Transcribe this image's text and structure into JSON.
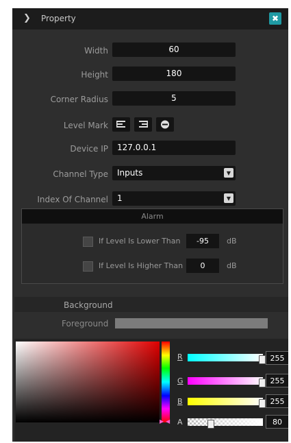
{
  "header": {
    "title": "Property",
    "expand_icon": "chevron-right-icon",
    "pin_icon": "pin-icon"
  },
  "props": {
    "width_label": "Width",
    "width_value": "60",
    "height_label": "Height",
    "height_value": "180",
    "corner_label": "Corner Radius",
    "corner_value": "5",
    "level_mark_label": "Level Mark",
    "level_mark_icons": [
      "align-left-icon",
      "align-right-icon",
      "minus-circle-icon"
    ],
    "device_ip_label": "Device IP",
    "device_ip_value": "127.0.0.1",
    "channel_type_label": "Channel Type",
    "channel_type_value": "Inputs",
    "index_label": "Index Of Channel",
    "index_value": "1"
  },
  "alarm": {
    "title": "Alarm",
    "lower_label": "If Level Is Lower Than",
    "lower_value": "-95",
    "lower_unit": "dB",
    "higher_label": "If Level Is Higher Than",
    "higher_value": "0",
    "higher_unit": "dB"
  },
  "background": {
    "title": "Background",
    "foreground_label": "Foreground",
    "foreground_color": "#7c7c7c"
  },
  "picker": {
    "channels": [
      {
        "label": "R",
        "value": "255"
      },
      {
        "label": "G",
        "value": "255"
      },
      {
        "label": "B",
        "value": "255"
      },
      {
        "label": "A",
        "value": "80"
      }
    ]
  },
  "colors": {
    "panel": "#2e2e2e",
    "header": "#1c1c1c",
    "field": "#141414",
    "accent": "#1f9aa3"
  }
}
